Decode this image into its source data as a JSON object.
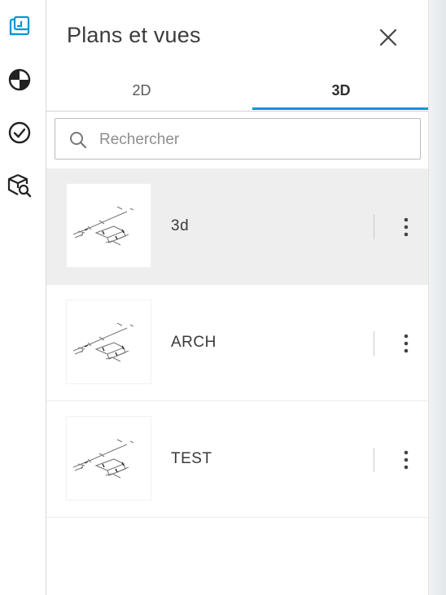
{
  "panel": {
    "title": "Plans et vues",
    "tabs": [
      {
        "label": "2D",
        "active": false
      },
      {
        "label": "3D",
        "active": true
      }
    ],
    "search": {
      "placeholder": "Rechercher",
      "value": ""
    },
    "items": [
      {
        "label": "3d",
        "selected": true
      },
      {
        "label": "ARCH",
        "selected": false
      },
      {
        "label": "TEST",
        "selected": false
      }
    ]
  },
  "rail": {
    "icons": [
      "sheets-views-icon",
      "model-browser-icon",
      "issues-check-icon",
      "search-model-icon"
    ]
  },
  "colors": {
    "accent": "#0696d7",
    "selected_row": "#eeeeee",
    "title_text": "#3c3c3c"
  }
}
